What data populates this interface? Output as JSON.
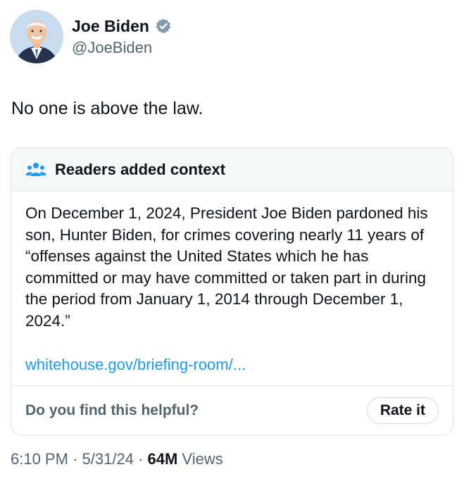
{
  "author": {
    "display_name": "Joe Biden",
    "handle": "@JoeBiden",
    "verified_badge_color": "#829aab"
  },
  "tweet": {
    "text": "No one is above the law."
  },
  "community_note": {
    "title": "Readers added context",
    "icon": "readers-icon",
    "accent_color": "#1d9bf0",
    "body": "On December 1, 2024, President Joe Biden pardoned his son, Hunter Biden, for crimes covering nearly 11 years of “offenses against the United States which he has committed or may have committed or taken part in during the period from January 1, 2014 through December 1, 2024.”",
    "link_text": "whitehouse.gov/briefing-room/...",
    "helpful_question": "Do you find this helpful?",
    "rate_button_label": "Rate it"
  },
  "meta": {
    "time": "6:10 PM",
    "separator": "·",
    "date": "5/31/24",
    "views_count": "64M",
    "views_label": "Views"
  }
}
